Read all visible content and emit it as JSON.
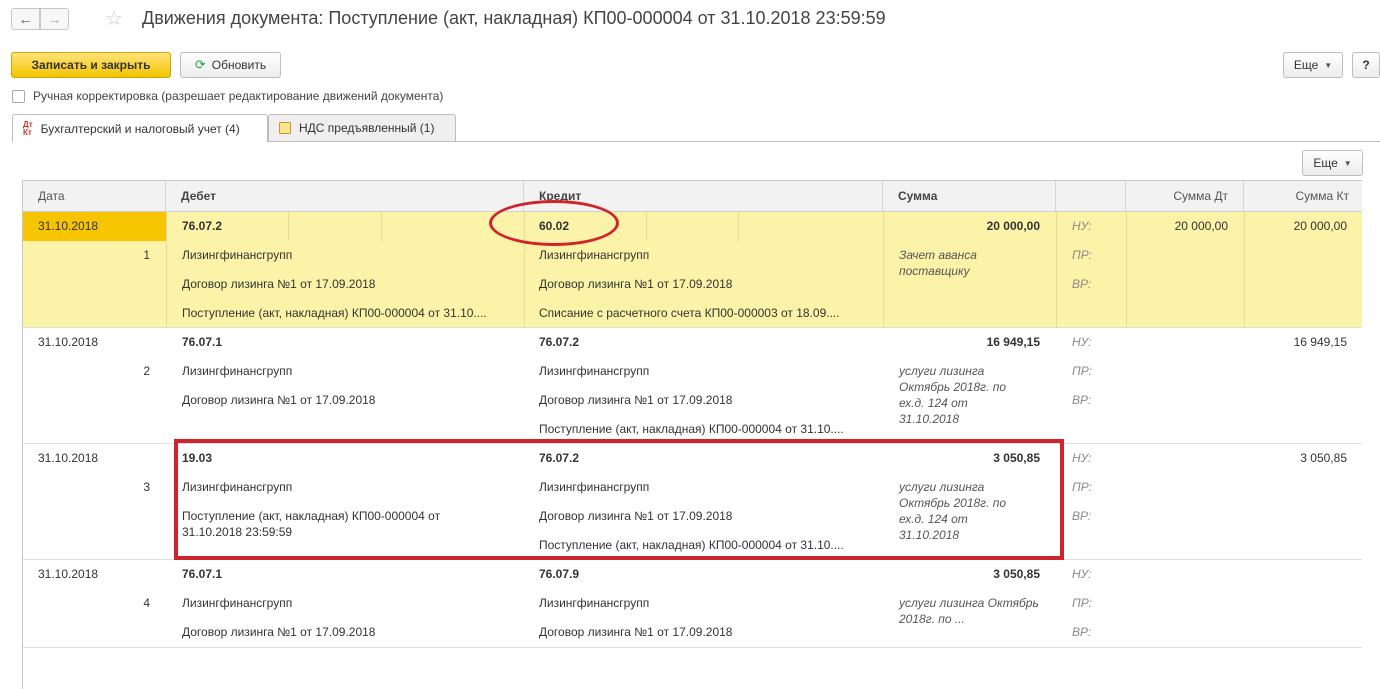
{
  "window": {
    "title": "Движения документа: Поступление (акт, накладная) КП00-000004 от 31.10.2018 23:59:59"
  },
  "nav": {
    "back_glyph": "←",
    "forward_glyph": "→",
    "star_glyph": "☆"
  },
  "toolbar": {
    "save_close_label": "Записать и закрыть",
    "refresh_label": "Обновить",
    "refresh_icon": "refresh-icon",
    "more_label": "Еще",
    "help_label": "?",
    "manual_correction_label": "Ручная корректировка (разрешает редактирование движений документа)",
    "manual_correction_checked": false
  },
  "tabs": [
    {
      "label": "Бухгалтерский и налоговый учет (4)",
      "icon": "dt-kt-icon",
      "active": true
    },
    {
      "label": "НДС предъявленный (1)",
      "icon": "register-icon",
      "active": false
    }
  ],
  "table_toolbar": {
    "more_label": "Еще"
  },
  "columns": {
    "date": "Дата",
    "debit": "Дебет",
    "credit": "Кредит",
    "amount": "Сумма",
    "amount_dt": "Сумма Дт",
    "amount_kt": "Сумма Кт"
  },
  "rows": [
    {
      "date": "31.10.2018",
      "num": "1",
      "debit": [
        "76.07.2",
        "Лизингфинансгрупп",
        "Договор лизинга №1 от 17.09.2018",
        "Поступление (акт, накладная) КП00-000004 от 31.10...."
      ],
      "credit": [
        "60.02",
        "Лизингфинансгрупп",
        "Договор лизинга №1 от 17.09.2018",
        "Списание с расчетного счета КП00-000003 от 18.09...."
      ],
      "amount": "20 000,00",
      "content": "Зачет аванса поставщику",
      "nu": "НУ:",
      "pr": "ПР:",
      "vr": "ВР:",
      "amount_dt": "20 000,00",
      "amount_kt": "20 000,00",
      "selected": true
    },
    {
      "date": "31.10.2018",
      "num": "2",
      "debit": [
        "76.07.1",
        "Лизингфинансгрупп",
        "Договор лизинга №1 от 17.09.2018",
        ""
      ],
      "credit": [
        "76.07.2",
        "Лизингфинансгрупп",
        "Договор лизинга №1 от 17.09.2018",
        "Поступление (акт, накладная) КП00-000004 от 31.10...."
      ],
      "amount": "16 949,15",
      "content": "услуги лизинга Октябрь 2018г. по ех.д. 124 от 31.10.2018",
      "nu": "НУ:",
      "pr": "ПР:",
      "vr": "ВР:",
      "amount_dt": "",
      "amount_kt": "16 949,15",
      "selected": false
    },
    {
      "date": "31.10.2018",
      "num": "3",
      "debit": [
        "19.03",
        "Лизингфинансгрупп",
        "Поступление (акт, накладная) КП00-000004 от 31.10.2018 23:59:59",
        ""
      ],
      "credit": [
        "76.07.2",
        "Лизингфинансгрупп",
        "Договор лизинга №1 от 17.09.2018",
        "Поступление (акт, накладная) КП00-000004 от 31.10...."
      ],
      "amount": "3 050,85",
      "content": "услуги лизинга Октябрь 2018г. по ех.д. 124 от 31.10.2018",
      "nu": "НУ:",
      "pr": "ПР:",
      "vr": "ВР:",
      "amount_dt": "",
      "amount_kt": "3 050,85",
      "selected": false
    },
    {
      "date": "31.10.2018",
      "num": "4",
      "debit": [
        "76.07.1",
        "Лизингфинансгрупп",
        "Договор лизинга №1 от 17.09.2018",
        ""
      ],
      "credit": [
        "76.07.9",
        "Лизингфинансгрупп",
        "Договор лизинга №1 от 17.09.2018",
        ""
      ],
      "amount": "3 050,85",
      "content": "услуги лизинга Октябрь 2018г. по ...",
      "nu": "НУ:",
      "pr": "ПР:",
      "vr": "ВР:",
      "amount_dt": "",
      "amount_kt": "",
      "selected": false
    }
  ],
  "annotations": {
    "ellipse_color": "#d0242c",
    "rect_color": "#d0242c"
  }
}
